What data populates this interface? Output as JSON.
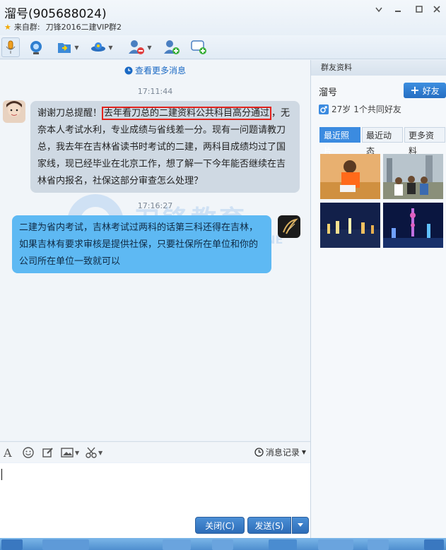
{
  "window": {
    "title": "溜号(905688024)",
    "source_label": "来自群:",
    "source_group": "刀锋2016二建VIP群2"
  },
  "toolbar": {
    "icons": [
      "microphone-icon",
      "video-icon",
      "send-file-icon",
      "remote-assist-icon",
      "block-user-icon",
      "add-user-icon",
      "create-discussion-icon"
    ]
  },
  "chat": {
    "view_more": "查看更多消息",
    "messages": [
      {
        "time": "17:11:44",
        "side": "left",
        "text_before": "谢谢刀总提醒！",
        "text_highlight": "去年看刀总的二建资料公共科目高分通过",
        "text_after": "，无奈本人考试水利，专业成绩与省线差一分。现有一问题请教刀总，我去年在吉林省读书时考试的二建，两科目成绩均过了国家线，现已经毕业在北京工作，想了解一下今年能否继续在吉林省内报名，社保这部分审查怎么处理？"
      },
      {
        "time": "17:16:27",
        "side": "right",
        "text": "二建为省内考试，吉林考试过两科的话第三科还得在吉林，如果吉林有要求审核是提供社保，只要社保所在单位和你的公司所在单位一致就可以"
      }
    ],
    "watermark_text": "刀锋教育",
    "watermark_sub": "LINE"
  },
  "input": {
    "message_log": "消息记录",
    "close_label": "关闭(C)",
    "send_label": "发送(S)"
  },
  "profile": {
    "header": "群友资料",
    "name": "溜号",
    "add_friend": "好友",
    "age": "27岁",
    "mutual": "1个共同好友",
    "tabs": [
      "最近照片",
      "最近动态",
      "更多资料"
    ],
    "active_tab": 0
  },
  "colors": {
    "accent": "#3b8be0",
    "left_bubble": "#cfd9e3",
    "right_bubble": "#5eb9f3",
    "highlight_box": "#e3241e"
  }
}
